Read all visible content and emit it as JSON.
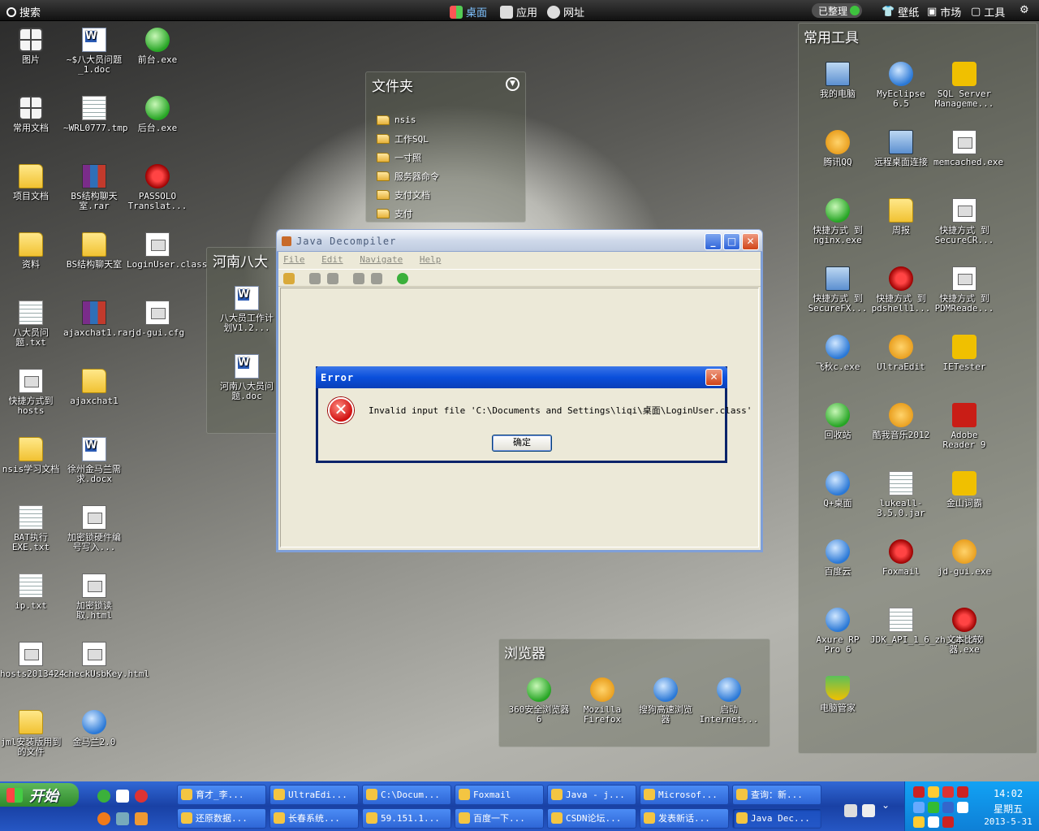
{
  "topbar": {
    "search": "搜索",
    "nav": [
      "桌面",
      "应用",
      "网址"
    ],
    "status": "已整理",
    "right": [
      "壁纸",
      "市场",
      "工具"
    ]
  },
  "desktop_icons": [
    "图片",
    "~$八大员问题_1.doc",
    "前台.exe",
    "常用文档",
    "~WRL0777.tmp",
    "后台.exe",
    "项目文档",
    "BS结构聊天室.rar",
    "PASSOLO Translat...",
    "资料",
    "BS结构聊天室",
    "LoginUser.class",
    "八大员问题.txt",
    "ajaxchat1.rar",
    "jd-gui.cfg",
    "快捷方式到hosts",
    "ajaxchat1",
    "nsis学习文档",
    "徐州金马兰需求.docx",
    "BAT执行EXE.txt",
    "加密锁硬件编号写入...",
    "ip.txt",
    "加密锁读取.html",
    "hosts2013424",
    "checkUsbKey.html",
    "jml安装版用到的文件",
    "金马兰2.0"
  ],
  "folders_panel": {
    "title": "文件夹",
    "items": [
      "nsis",
      "工作SQL",
      "一寸照",
      "服务器命令",
      "支付文档",
      "支付"
    ]
  },
  "henan_panel": {
    "title": "河南八大",
    "items": [
      "八大员工作计划V1.2...",
      "河南八大员问题.doc"
    ]
  },
  "tools_panel": {
    "title": "常用工具",
    "items": [
      "我的电脑",
      "MyEclipse 6.5",
      "SQL Server Manageme...",
      "腾讯QQ",
      "远程桌面连接",
      "memcached.exe",
      "快捷方式 到 nginx.exe",
      "周报",
      "快捷方式 到 SecureCR...",
      "快捷方式 到 SecureFX...",
      "快捷方式 到 pdshell1...",
      "快捷方式 到 PDMReade...",
      "飞秋c.exe",
      "UltraEdit",
      "IETester",
      "回收站",
      "酷我音乐2012",
      "Adobe Reader 9",
      "Q+桌面",
      "lukeall-3.5.0.jar",
      "金山词霸",
      "百度云",
      "Foxmail",
      "jd-gui.exe",
      "Axure RP Pro 6",
      "JDK_API_1_6_zh_CN.CHM",
      "文本比较器.exe",
      "电脑管家"
    ]
  },
  "browser_panel": {
    "title": "浏览器",
    "items": [
      "360安全浏览器6",
      "Mozilla Firefox",
      "搜狗高速浏览器",
      "启动 Internet..."
    ]
  },
  "java_window": {
    "title": "Java Decompiler",
    "menu": [
      "File",
      "Edit",
      "Navigate",
      "Help"
    ]
  },
  "error_dialog": {
    "title": "Error",
    "message": "Invalid input file 'C:\\Documents and Settings\\liqi\\桌面\\LoginUser.class'",
    "ok": "确定"
  },
  "taskbar": {
    "start": "开始",
    "tasks_row1": [
      "育才_李...",
      "UltraEdi...",
      "C:\\Docum...",
      "Foxmail",
      "Java - j...",
      "Microsof...",
      "查询：新..."
    ],
    "tasks_row2": [
      "还原数据...",
      "长春系统...",
      "59.151.1...",
      "百度一下...",
      "CSDN论坛...",
      "发表新话...",
      "Java Dec..."
    ],
    "time": "14:02",
    "weekday": "星期五",
    "date": "2013-5-31"
  }
}
